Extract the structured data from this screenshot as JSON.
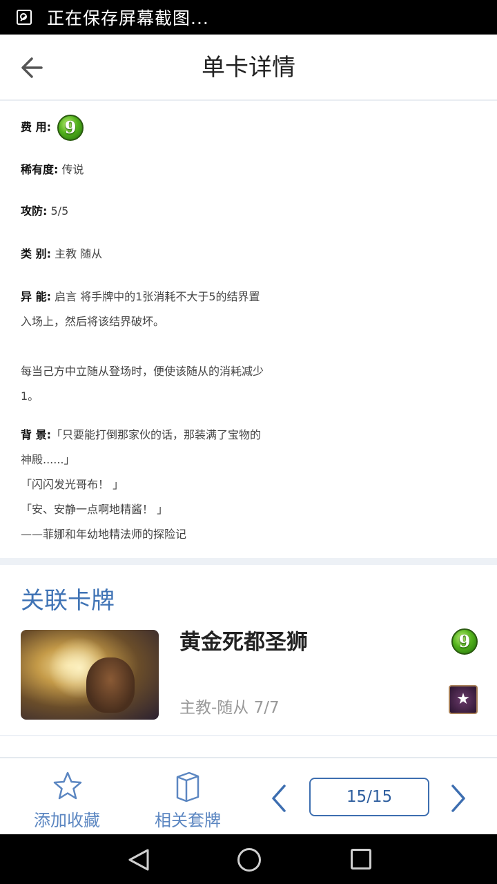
{
  "status_bar": {
    "text": "正在保存屏幕截图..."
  },
  "header": {
    "title": "单卡详情"
  },
  "detail": {
    "cost_label": "费 用:",
    "cost_value": "9",
    "rarity_label": "稀有度:",
    "rarity_value": " 传说",
    "stats_label": "攻防:",
    "stats_value": " 5/5",
    "type_label": "类 别:",
    "type_value": " 主教 随从",
    "ability_label": "异 能:",
    "ability_line1": " 启言 将手牌中的1张消耗不大于5的结界置",
    "ability_line2": "入场上，然后将该结界破坏。",
    "ability_line3": "每当己方中立随从登场时，便使该随从的消耗减少",
    "ability_line4": "1。",
    "background_label": "背 景:",
    "background_line1": "「只要能打倒那家伙的话，那装满了宝物的",
    "background_line2": "神殿......」",
    "background_line3": "「闪闪发光哥布！ 」",
    "background_line4": "「安、安静一点啊地精酱！ 」",
    "background_line5": "——菲娜和年幼地精法师的探险记"
  },
  "related": {
    "title": "关联卡牌",
    "card": {
      "name": "黄金死都圣狮",
      "subtitle": "主教-随从  7/7",
      "cost": "9"
    }
  },
  "bottom_bar": {
    "favorite_label": "添加收藏",
    "deck_label": "相关套牌",
    "page": "15/15"
  },
  "colors": {
    "accent": "#3f73b5",
    "cost_green": "#53b21c"
  }
}
